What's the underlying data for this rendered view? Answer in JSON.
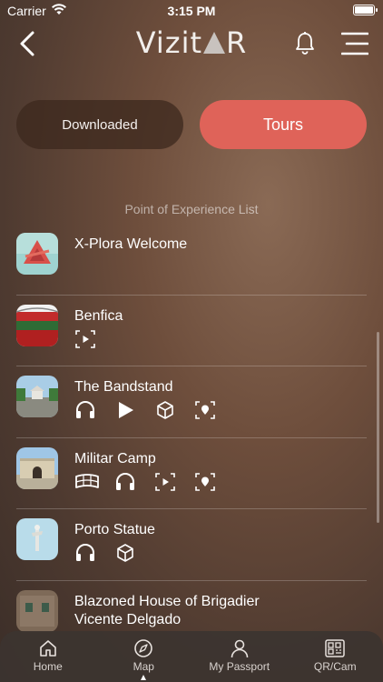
{
  "status": {
    "carrier": "Carrier",
    "time": "3:15 PM"
  },
  "header": {
    "logo_prefix": "Vizit",
    "logo_suffix": "R"
  },
  "segments": {
    "downloaded": "Downloaded",
    "tours": "Tours",
    "active": "tours"
  },
  "section_title": "Point of Experience List",
  "items": [
    {
      "title": "X-Plora Welcome",
      "icons": []
    },
    {
      "title": "Benfica",
      "icons": [
        "video-icon"
      ]
    },
    {
      "title": "The Bandstand",
      "icons": [
        "headphones-icon",
        "play-icon",
        "cube-icon",
        "location-icon"
      ]
    },
    {
      "title": "Militar Camp",
      "icons": [
        "panorama-icon",
        "headphones-icon",
        "video-icon",
        "location-icon"
      ]
    },
    {
      "title": "Porto Statue",
      "icons": [
        "headphones-icon",
        "cube-icon"
      ]
    },
    {
      "title": "Blazoned House of Brigadier Vicente Delgado",
      "title_line1": "Blazoned House of Brigadier",
      "title_line2": "Vicente Delgado",
      "icons": []
    }
  ],
  "tabs": [
    {
      "label": "Home",
      "icon": "home-icon"
    },
    {
      "label": "Map",
      "icon": "compass-icon"
    },
    {
      "label": "My Passport",
      "icon": "person-icon"
    },
    {
      "label": "QR/Cam",
      "icon": "qr-icon"
    }
  ],
  "colors": {
    "accent": "#df6359",
    "segment_inactive": "#3c281e"
  }
}
